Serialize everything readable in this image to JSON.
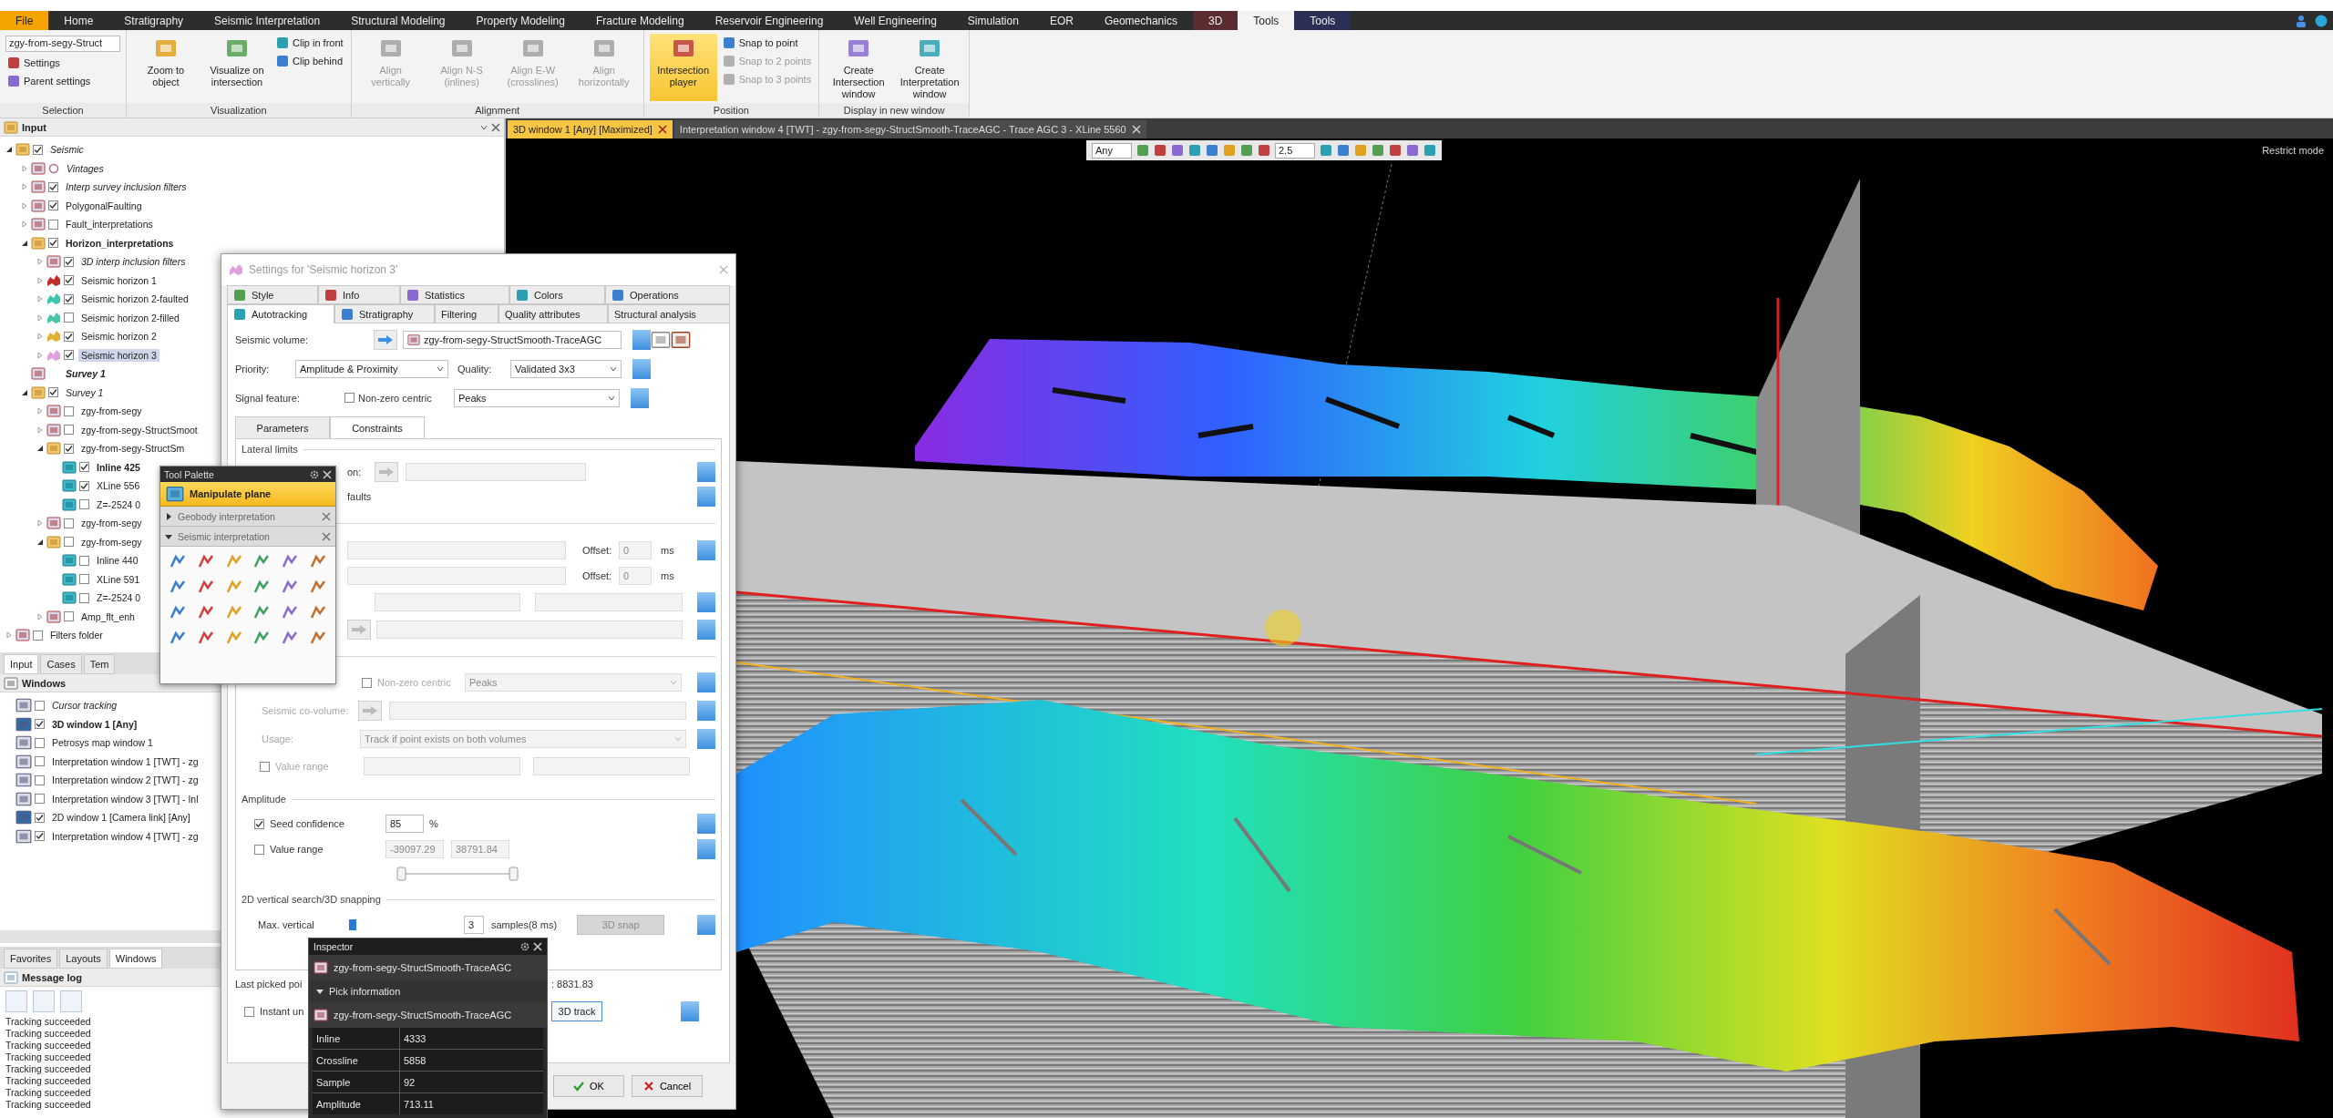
{
  "menu_tabs": [
    {
      "label": "File",
      "kind": "file",
      "selected": false
    },
    {
      "label": "Home",
      "kind": "tab",
      "selected": false
    },
    {
      "label": "Stratigraphy",
      "kind": "tab",
      "selected": false
    },
    {
      "label": "Seismic Interpretation",
      "kind": "tab",
      "selected": false
    },
    {
      "label": "Structural Modeling",
      "kind": "tab",
      "selected": false
    },
    {
      "label": "Property Modeling",
      "kind": "tab",
      "selected": false
    },
    {
      "label": "Fracture Modeling",
      "kind": "tab",
      "selected": false
    },
    {
      "label": "Reservoir Engineering",
      "kind": "tab",
      "selected": false
    },
    {
      "label": "Well Engineering",
      "kind": "tab",
      "selected": false
    },
    {
      "label": "Simulation",
      "kind": "tab",
      "selected": false
    },
    {
      "label": "EOR",
      "kind": "tab",
      "selected": false
    },
    {
      "label": "Geomechanics",
      "kind": "tab",
      "selected": false
    },
    {
      "label": "3D",
      "kind": "context",
      "color": "#5a2c30",
      "selected": false
    },
    {
      "label": "Tools",
      "kind": "tab",
      "selected": true
    },
    {
      "label": "Tools",
      "kind": "context",
      "color": "#2c2f55",
      "selected": false
    }
  ],
  "ribbon": {
    "groups": [
      {
        "title": "Selection",
        "items": [
          {
            "kind": "field",
            "label": "zgy-from-segy-Struct"
          },
          {
            "kind": "small",
            "label": "Settings",
            "disabled": false
          },
          {
            "kind": "small",
            "label": "Parent settings",
            "disabled": false
          }
        ]
      },
      {
        "title": "Visualization",
        "items": [
          {
            "kind": "large",
            "label": "Zoom to object",
            "disabled": false,
            "selected": false
          },
          {
            "kind": "large",
            "label": "Visualize on intersection",
            "disabled": false,
            "selected": false
          },
          {
            "kind": "small",
            "label": "Clip in front",
            "disabled": false
          },
          {
            "kind": "small",
            "label": "Clip behind",
            "disabled": false
          }
        ]
      },
      {
        "title": "Alignment",
        "items": [
          {
            "kind": "large",
            "label": "Align vertically",
            "disabled": true,
            "selected": false
          },
          {
            "kind": "large",
            "label": "Align N-S (inlines)",
            "disabled": true,
            "selected": false
          },
          {
            "kind": "large",
            "label": "Align E-W (crosslines)",
            "disabled": true,
            "selected": false
          },
          {
            "kind": "large",
            "label": "Align horizontally",
            "disabled": true,
            "selected": false
          }
        ]
      },
      {
        "title": "Position",
        "items": [
          {
            "kind": "large",
            "label": "Intersection player",
            "disabled": false,
            "selected": true
          },
          {
            "kind": "small",
            "label": "Snap to point",
            "disabled": false
          },
          {
            "kind": "small",
            "label": "Snap to 2 points",
            "disabled": true
          },
          {
            "kind": "small",
            "label": "Snap to 3 points",
            "disabled": true
          }
        ]
      },
      {
        "title": "Display in new window",
        "items": [
          {
            "kind": "large",
            "label": "Create Intersection window",
            "disabled": false,
            "selected": false
          },
          {
            "kind": "large",
            "label": "Create Interpretation window",
            "disabled": false,
            "selected": false
          }
        ]
      }
    ]
  },
  "input_panel": {
    "title": "Input",
    "tree": [
      {
        "label": "Seismic",
        "kind": "check",
        "checked": true,
        "expanded": true,
        "bold": false,
        "italic": true,
        "selected": false,
        "children": [
          {
            "label": "Vintages",
            "kind": "dot",
            "expanded": false,
            "bold": false,
            "italic": true,
            "selected": false
          },
          {
            "label": "Interp survey inclusion filters",
            "kind": "check",
            "checked": true,
            "expanded": false,
            "bold": false,
            "italic": true,
            "selected": false
          },
          {
            "label": "PolygonalFaulting",
            "kind": "check",
            "checked": true,
            "expanded": false,
            "bold": false,
            "italic": false,
            "selected": false
          },
          {
            "label": "Fault_interpretations",
            "kind": "check",
            "checked": false,
            "expanded": false,
            "bold": false,
            "italic": false,
            "selected": false
          },
          {
            "label": "Horizon_interpretations",
            "kind": "check",
            "checked": true,
            "expanded": true,
            "bold": true,
            "italic": false,
            "selected": false,
            "children": [
              {
                "label": "3D interp inclusion filters",
                "kind": "check",
                "checked": true,
                "expanded": false,
                "bold": false,
                "italic": true,
                "selected": false
              },
              {
                "label": "Seismic horizon 1",
                "kind": "check",
                "checked": true,
                "expanded": false,
                "bold": false,
                "italic": false,
                "selected": false,
                "color": "#c0302a"
              },
              {
                "label": "Seismic horizon 2-faulted",
                "kind": "check",
                "checked": true,
                "expanded": false,
                "bold": false,
                "italic": false,
                "selected": false,
                "color": "#3cc8b0"
              },
              {
                "label": "Seismic horizon 2-filled",
                "kind": "check",
                "checked": false,
                "expanded": false,
                "bold": false,
                "italic": false,
                "selected": false,
                "color": "#46c8a8"
              },
              {
                "label": "Seismic horizon 2",
                "kind": "check",
                "checked": true,
                "expanded": false,
                "bold": false,
                "italic": false,
                "selected": false,
                "color": "#e0b030"
              },
              {
                "label": "Seismic horizon 3",
                "kind": "check",
                "checked": true,
                "expanded": false,
                "bold": false,
                "italic": false,
                "selected": true,
                "color": "#e0a0e0"
              }
            ]
          },
          {
            "label": "Survey 1",
            "kind": "none",
            "bold": true,
            "italic": true,
            "selected": false
          },
          {
            "label": "Survey 1",
            "kind": "check",
            "checked": true,
            "expanded": true,
            "bold": false,
            "italic": true,
            "selected": false,
            "children": [
              {
                "label": "zgy-from-segy",
                "kind": "check",
                "checked": false,
                "expanded": false,
                "bold": false,
                "italic": false,
                "selected": false
              },
              {
                "label": "zgy-from-segy-StructSmoot",
                "kind": "check",
                "checked": false,
                "expanded": false,
                "bold": false,
                "italic": false,
                "selected": false
              },
              {
                "label": "zgy-from-segy-StructSm",
                "kind": "check",
                "checked": true,
                "expanded": true,
                "bold": false,
                "italic": false,
                "selected": false,
                "children": [
                  {
                    "label": "Inline 425",
                    "kind": "check",
                    "checked": true,
                    "bold": true,
                    "italic": false,
                    "selected": false
                  },
                  {
                    "label": "XLine 556",
                    "kind": "check",
                    "checked": true,
                    "bold": false,
                    "italic": false,
                    "selected": false
                  },
                  {
                    "label": "Z=-2524 0",
                    "kind": "check",
                    "checked": false,
                    "bold": false,
                    "italic": false,
                    "selected": false
                  }
                ]
              },
              {
                "label": "zgy-from-segy",
                "kind": "check",
                "checked": false,
                "expanded": false,
                "bold": false,
                "italic": false,
                "selected": false
              },
              {
                "label": "zgy-from-segy",
                "kind": "check",
                "checked": false,
                "expanded": true,
                "bold": false,
                "italic": false,
                "selected": false,
                "children": [
                  {
                    "label": "Inline 440",
                    "kind": "check",
                    "checked": false,
                    "bold": false,
                    "italic": false,
                    "selected": false
                  },
                  {
                    "label": "XLine 591",
                    "kind": "check",
                    "checked": false,
                    "bold": false,
                    "italic": false,
                    "selected": false
                  },
                  {
                    "label": "Z=-2524 0",
                    "kind": "check",
                    "checked": false,
                    "bold": false,
                    "italic": false,
                    "selected": false
                  }
                ]
              },
              {
                "label": "Amp_flt_enh",
                "kind": "check",
                "checked": false,
                "expanded": false,
                "bold": false,
                "italic": false,
                "selected": false
              }
            ]
          }
        ]
      },
      {
        "label": "Filters folder",
        "kind": "check",
        "checked": false,
        "expanded": false,
        "bold": false,
        "italic": false,
        "selected": false
      }
    ],
    "tabs": [
      {
        "label": "Input",
        "selected": true
      },
      {
        "label": "Cases",
        "selected": false
      },
      {
        "label": "Tem",
        "selected": false
      }
    ]
  },
  "windows_panel": {
    "title": "Windows",
    "items": [
      {
        "label": "Cursor tracking",
        "checked": false,
        "bold": false,
        "italic": true
      },
      {
        "label": "3D window 1 [Any]",
        "checked": true,
        "bold": true,
        "italic": false
      },
      {
        "label": "Petrosys map window 1",
        "checked": false,
        "bold": false,
        "italic": false
      },
      {
        "label": "Interpretation window 1 [TWT] - zg",
        "checked": false,
        "bold": false,
        "italic": false
      },
      {
        "label": "Interpretation window 2 [TWT] - zg",
        "checked": false,
        "bold": false,
        "italic": false
      },
      {
        "label": "Interpretation window 3 [TWT] - Inl",
        "checked": false,
        "bold": false,
        "italic": false
      },
      {
        "label": "2D window 1 [Camera link] [Any]",
        "checked": true,
        "bold": false,
        "italic": false
      },
      {
        "label": "Interpretation window 4 [TWT] - zg",
        "checked": true,
        "bold": false,
        "italic": false
      }
    ],
    "tabs": [
      {
        "label": "Favorites",
        "selected": false
      },
      {
        "label": "Layouts",
        "selected": false
      },
      {
        "label": "Windows",
        "selected": true
      }
    ]
  },
  "message_log": {
    "title": "Message log",
    "lines": [
      "Tracking succeeded",
      "Tracking succeeded",
      "Tracking succeeded",
      "Tracking succeeded",
      "Tracking succeeded",
      "Tracking succeeded",
      "Tracking succeeded",
      "Tracking succeeded"
    ]
  },
  "doc_tabs": [
    {
      "label": "3D window 1 [Any] [Maximized]",
      "selected": true
    },
    {
      "label": "Interpretation window 4 [TWT] - zgy-from-segy-StructSmooth-TraceAGC - Trace AGC 3 - XLine 5560",
      "selected": false
    }
  ],
  "viewport": {
    "domain": "Any",
    "scale": "2.5",
    "mode": "Restrict mode"
  },
  "settings_dialog": {
    "title": "Settings for 'Seismic horizon 3'",
    "tabs_row1": [
      {
        "label": "Style",
        "selected": false
      },
      {
        "label": "Info",
        "selected": false
      },
      {
        "label": "Statistics",
        "selected": false
      },
      {
        "label": "Colors",
        "selected": false
      },
      {
        "label": "Operations",
        "selected": false
      }
    ],
    "tabs_row2": [
      {
        "label": "Autotracking",
        "selected": true
      },
      {
        "label": "Stratigraphy",
        "selected": false
      },
      {
        "label": "Filtering",
        "selected": false
      },
      {
        "label": "Quality attributes",
        "selected": false
      },
      {
        "label": "Structural analysis",
        "selected": false
      }
    ],
    "seismic_volume": {
      "label": "Seismic volume:",
      "value": "zgy-from-segy-StructSmooth-TraceAGC"
    },
    "priority": {
      "label": "Priority:",
      "value": "Amplitude & Proximity"
    },
    "quality": {
      "label": "Quality:",
      "value": "Validated 3x3"
    },
    "signal_feature": {
      "label": "Signal feature:",
      "checkbox_label": "Non-zero centric",
      "checked": false,
      "value": "Peaks"
    },
    "subtabs": [
      {
        "label": "Parameters",
        "selected": false
      },
      {
        "label": "Constraints",
        "selected": true
      }
    ],
    "lateral_limits": {
      "title": "Lateral limits",
      "row_1_label": "on:",
      "row_2_label": "faults"
    },
    "offsets": [
      {
        "label": "Offset:",
        "value": "0",
        "unit": "ms"
      },
      {
        "label": "Offset:",
        "value": "0",
        "unit": "ms"
      }
    ],
    "covolume": {
      "checkbox_label": "Non-zero centric",
      "checked": false,
      "feature": "Peaks",
      "label": "Seismic co-volume:",
      "usage_label": "Usage:",
      "usage": "Track if point exists on both volumes",
      "range_label": "Value range",
      "range_checked": false
    },
    "amplitude": {
      "title": "Amplitude",
      "seed_label": "Seed confidence",
      "seed_checked": true,
      "seed_value": "85",
      "seed_unit": "%",
      "range_label": "Value range",
      "range_checked": false,
      "range_min": "-39097.29",
      "range_max": "38791.84",
      "slider_low": {
        "level": 0
      },
      "slider_high": {
        "level": 1
      }
    },
    "snapping": {
      "title": "2D vertical search/3D snapping",
      "label": "Max. vertical",
      "value": "3",
      "unit": "samples(8 ms)",
      "button": "3D snap"
    },
    "last_picked": {
      "label": "Last picked poi",
      "value": ": 8831.83"
    },
    "instant": {
      "label": "Instant un",
      "checked": false,
      "button": "3D track"
    },
    "buttons": [
      {
        "label": "OK",
        "kind": "ok"
      },
      {
        "label": "Cancel",
        "kind": "cancel"
      }
    ]
  },
  "tool_palette": {
    "title": "Tool Palette",
    "tool": {
      "label": "Manipulate plane",
      "selected": true
    },
    "sections": [
      {
        "label": "Geobody interpretation",
        "expanded": false
      },
      {
        "label": "Seismic interpretation",
        "expanded": true
      }
    ]
  },
  "inspector": {
    "title": "Inspector",
    "object": "zgy-from-segy-StructSmooth-TraceAGC",
    "section": {
      "label": "Pick information",
      "expanded": true
    },
    "source": "zgy-from-segy-StructSmooth-TraceAGC",
    "rows": [
      {
        "key": "Inline",
        "value": "4333"
      },
      {
        "key": "Crossline",
        "value": "5858"
      },
      {
        "key": "Sample",
        "value": "92"
      },
      {
        "key": "Amplitude",
        "value": "713.11"
      }
    ]
  }
}
